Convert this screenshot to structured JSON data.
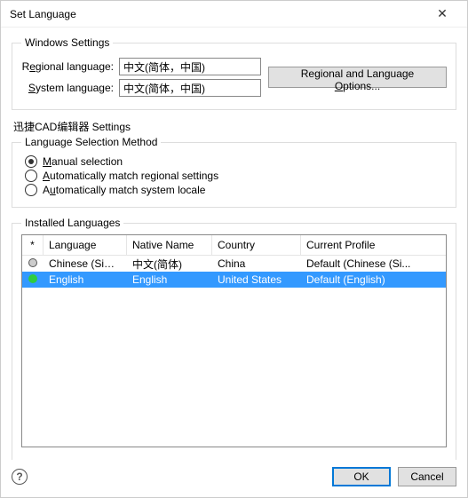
{
  "titlebar": {
    "title": "Set Language"
  },
  "windows_settings": {
    "legend": "Windows Settings",
    "regional_label_pre": "R",
    "regional_label_ul": "e",
    "regional_label_post": "gional language:",
    "regional_value": "中文(简体，中国)",
    "system_label_pre": "",
    "system_label_ul": "S",
    "system_label_post": "ystem language:",
    "system_value": "中文(简体，中国)",
    "btn_pre": "Regional and Language ",
    "btn_ul": "O",
    "btn_post": "ptions..."
  },
  "app_settings_label": "迅捷CAD编辑器 Settings",
  "lang_method": {
    "legend": "Language Selection Method",
    "manual_ul": "M",
    "manual_post": "anual selection",
    "auto_regional_ul": "A",
    "auto_regional_post": "utomatically match regional settings",
    "auto_system_pre": "A",
    "auto_system_ul": "u",
    "auto_system_post": "tomatically match system locale"
  },
  "installed": {
    "legend": "Installed Languages",
    "headers": {
      "star": "*",
      "language": "Language",
      "native": "Native Name",
      "country": "Country",
      "profile": "Current Profile"
    },
    "rows": [
      {
        "status": "gray",
        "language": "Chinese (Simplif...",
        "native": "中文(简体)",
        "country": "China",
        "profile": "Default (Chinese (Si...",
        "selected": false
      },
      {
        "status": "green",
        "language": "English",
        "native": "English",
        "country": "United States",
        "profile": "Default (English)",
        "selected": true
      }
    ]
  },
  "footer": {
    "ok": "OK",
    "cancel": "Cancel"
  }
}
